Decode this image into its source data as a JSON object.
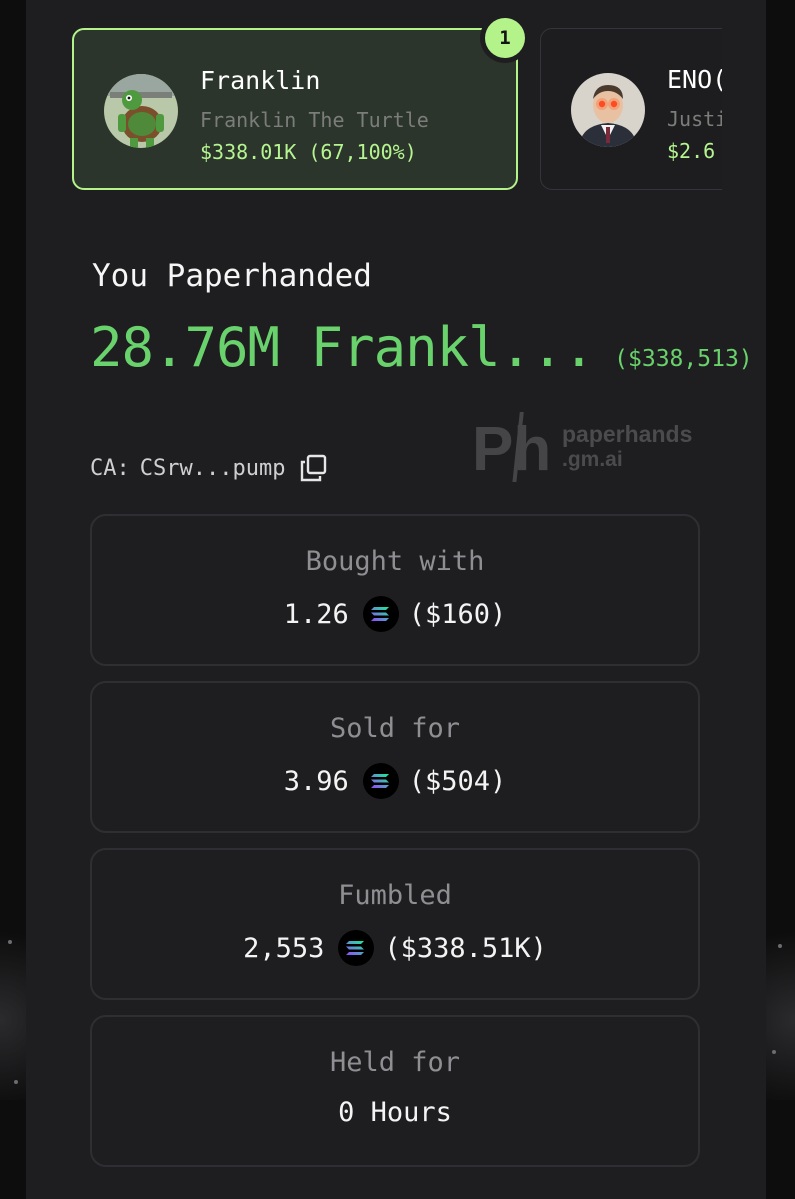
{
  "tokens": [
    {
      "rank": "1",
      "name": "Franklin",
      "subtitle": "Franklin The Turtle",
      "price": "$338.01K (67,100%)",
      "avatar_icon": "turtle-avatar",
      "selected": true
    },
    {
      "name": "ENO(",
      "subtitle": "Justi",
      "price": "$2.6",
      "avatar_icon": "man-laser-eyes-avatar",
      "selected": false
    }
  ],
  "headline": "You Paperhanded",
  "amount": "28.76M Frankl...",
  "amount_usd": "($338,513)",
  "contract": {
    "label": "CA:",
    "value": "CSrw...pump",
    "copy_icon": "copy-icon"
  },
  "watermark": {
    "logo_text": "Ph",
    "line1": "paperhands",
    "line2": ".gm.ai"
  },
  "stats": [
    {
      "label": "Bought with",
      "amount": "1.26",
      "usd": "($160)",
      "icon": "solana-icon"
    },
    {
      "label": "Sold for",
      "amount": "3.96",
      "usd": "($504)",
      "icon": "solana-icon"
    },
    {
      "label": "Fumbled",
      "amount": "2,553",
      "usd": "($338.51K)",
      "icon": "solana-icon"
    },
    {
      "label": "Held for",
      "value": "0 Hours"
    }
  ],
  "colors": {
    "accent_green": "#69d26c",
    "badge_green": "#b4f38a",
    "price_green": "#b5f590",
    "panel": "#1e1e20"
  }
}
